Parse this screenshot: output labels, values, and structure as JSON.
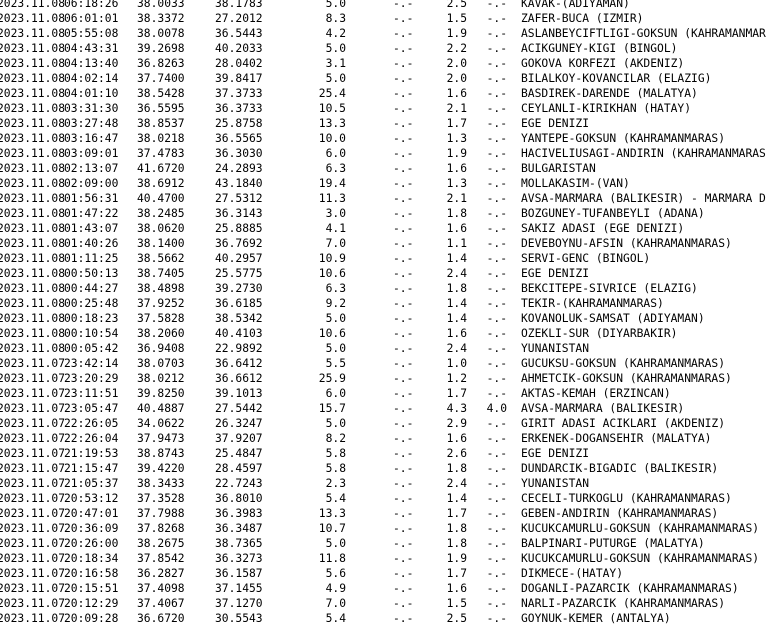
{
  "colors": {
    "background": "#ffffff",
    "text": "#000000"
  },
  "rows": [
    {
      "date": "2023.11.08",
      "time": "06:18:26",
      "lat": "38.0033",
      "lon": "38.1783",
      "depth": "5.0",
      "md": "-.-",
      "ml": "2.5",
      "mw": "-.-",
      "location": "KAVAK-(ADIYAMAN)"
    },
    {
      "date": "2023.11.08",
      "time": "06:01:01",
      "lat": "38.3372",
      "lon": "27.2012",
      "depth": "8.3",
      "md": "-.-",
      "ml": "1.5",
      "mw": "-.-",
      "location": "ZAFER-BUCA (IZMIR)"
    },
    {
      "date": "2023.11.08",
      "time": "05:55:08",
      "lat": "38.0078",
      "lon": "36.5443",
      "depth": "4.2",
      "md": "-.-",
      "ml": "1.9",
      "mw": "-.-",
      "location": "ASLANBEYCIFTLIGI-GOKSUN (KAHRAMANMARAS)"
    },
    {
      "date": "2023.11.08",
      "time": "04:43:31",
      "lat": "39.2698",
      "lon": "40.2033",
      "depth": "5.0",
      "md": "-.-",
      "ml": "2.2",
      "mw": "-.-",
      "location": "ACIKGUNEY-KIGI (BINGOL)"
    },
    {
      "date": "2023.11.08",
      "time": "04:13:40",
      "lat": "36.8263",
      "lon": "28.0402",
      "depth": "3.1",
      "md": "-.-",
      "ml": "2.0",
      "mw": "-.-",
      "location": "GOKOVA KORFEZI (AKDENIZ)"
    },
    {
      "date": "2023.11.08",
      "time": "04:02:14",
      "lat": "37.7400",
      "lon": "39.8417",
      "depth": "5.0",
      "md": "-.-",
      "ml": "2.0",
      "mw": "-.-",
      "location": "BILALKOY-KOVANCILAR (ELAZIG)"
    },
    {
      "date": "2023.11.08",
      "time": "04:01:10",
      "lat": "38.5428",
      "lon": "37.3733",
      "depth": "25.4",
      "md": "-.-",
      "ml": "1.6",
      "mw": "-.-",
      "location": "BASDIREK-DARENDE (MALATYA)"
    },
    {
      "date": "2023.11.08",
      "time": "03:31:30",
      "lat": "36.5595",
      "lon": "36.3733",
      "depth": "10.5",
      "md": "-.-",
      "ml": "2.1",
      "mw": "-.-",
      "location": "CEYLANLI-KIRIKHAN (HATAY)"
    },
    {
      "date": "2023.11.08",
      "time": "03:27:48",
      "lat": "38.8537",
      "lon": "25.8758",
      "depth": "13.3",
      "md": "-.-",
      "ml": "1.7",
      "mw": "-.-",
      "location": "EGE DENIZI"
    },
    {
      "date": "2023.11.08",
      "time": "03:16:47",
      "lat": "38.0218",
      "lon": "36.5565",
      "depth": "10.0",
      "md": "-.-",
      "ml": "1.3",
      "mw": "-.-",
      "location": "YANTEPE-GOKSUN (KAHRAMANMARAS)"
    },
    {
      "date": "2023.11.08",
      "time": "03:09:01",
      "lat": "37.4783",
      "lon": "36.3030",
      "depth": "6.0",
      "md": "-.-",
      "ml": "1.9",
      "mw": "-.-",
      "location": "HACIVELIUSAGI-ANDIRIN (KAHRAMANMARAS)"
    },
    {
      "date": "2023.11.08",
      "time": "02:13:07",
      "lat": "41.6720",
      "lon": "24.2893",
      "depth": "6.3",
      "md": "-.-",
      "ml": "1.6",
      "mw": "-.-",
      "location": "BULGARISTAN"
    },
    {
      "date": "2023.11.08",
      "time": "02:09:00",
      "lat": "38.6912",
      "lon": "43.1840",
      "depth": "19.4",
      "md": "-.-",
      "ml": "1.3",
      "mw": "-.-",
      "location": "MOLLAKASIM-(VAN)"
    },
    {
      "date": "2023.11.08",
      "time": "01:56:31",
      "lat": "40.4700",
      "lon": "27.5312",
      "depth": "11.3",
      "md": "-.-",
      "ml": "2.1",
      "mw": "-.-",
      "location": "AVSA-MARMARA (BALIKESIR) - MARMARA DE"
    },
    {
      "date": "2023.11.08",
      "time": "01:47:22",
      "lat": "38.2485",
      "lon": "36.3143",
      "depth": "3.0",
      "md": "-.-",
      "ml": "1.8",
      "mw": "-.-",
      "location": "BOZGUNEY-TUFANBEYLI (ADANA)"
    },
    {
      "date": "2023.11.08",
      "time": "01:43:07",
      "lat": "38.0620",
      "lon": "25.8885",
      "depth": "4.1",
      "md": "-.-",
      "ml": "1.6",
      "mw": "-.-",
      "location": "SAKIZ ADASI (EGE DENIZI)"
    },
    {
      "date": "2023.11.08",
      "time": "01:40:26",
      "lat": "38.1400",
      "lon": "36.7692",
      "depth": "7.0",
      "md": "-.-",
      "ml": "1.1",
      "mw": "-.-",
      "location": "DEVEBOYNU-AFSIN (KAHRAMANMARAS)"
    },
    {
      "date": "2023.11.08",
      "time": "01:11:25",
      "lat": "38.5662",
      "lon": "40.2957",
      "depth": "10.9",
      "md": "-.-",
      "ml": "1.4",
      "mw": "-.-",
      "location": "SERVI-GENC (BINGOL)"
    },
    {
      "date": "2023.11.08",
      "time": "00:50:13",
      "lat": "38.7405",
      "lon": "25.5775",
      "depth": "10.6",
      "md": "-.-",
      "ml": "2.4",
      "mw": "-.-",
      "location": "EGE DENIZI"
    },
    {
      "date": "2023.11.08",
      "time": "00:44:27",
      "lat": "38.4898",
      "lon": "39.2730",
      "depth": "6.3",
      "md": "-.-",
      "ml": "1.8",
      "mw": "-.-",
      "location": "BEKCITEPE-SIVRICE (ELAZIG)"
    },
    {
      "date": "2023.11.08",
      "time": "00:25:48",
      "lat": "37.9252",
      "lon": "36.6185",
      "depth": "9.2",
      "md": "-.-",
      "ml": "1.4",
      "mw": "-.-",
      "location": "TEKIR-(KAHRAMANMARAS)"
    },
    {
      "date": "2023.11.08",
      "time": "00:18:23",
      "lat": "37.5828",
      "lon": "38.5342",
      "depth": "5.0",
      "md": "-.-",
      "ml": "1.4",
      "mw": "-.-",
      "location": "KOVANOLUK-SAMSAT (ADIYAMAN)"
    },
    {
      "date": "2023.11.08",
      "time": "00:10:54",
      "lat": "38.2060",
      "lon": "40.4103",
      "depth": "10.6",
      "md": "-.-",
      "ml": "1.6",
      "mw": "-.-",
      "location": "OZEKLI-SUR (DIYARBAKIR)"
    },
    {
      "date": "2023.11.08",
      "time": "00:05:42",
      "lat": "36.9408",
      "lon": "22.9892",
      "depth": "5.0",
      "md": "-.-",
      "ml": "2.4",
      "mw": "-.-",
      "location": "YUNANISTAN"
    },
    {
      "date": "2023.11.07",
      "time": "23:42:14",
      "lat": "38.0703",
      "lon": "36.6412",
      "depth": "5.5",
      "md": "-.-",
      "ml": "1.0",
      "mw": "-.-",
      "location": "GUCUKSU-GOKSUN (KAHRAMANMARAS)"
    },
    {
      "date": "2023.11.07",
      "time": "23:20:29",
      "lat": "38.0212",
      "lon": "36.6612",
      "depth": "25.9",
      "md": "-.-",
      "ml": "1.2",
      "mw": "-.-",
      "location": "AHMETCIK-GOKSUN (KAHRAMANMARAS)"
    },
    {
      "date": "2023.11.07",
      "time": "23:11:51",
      "lat": "39.8250",
      "lon": "39.1013",
      "depth": "6.0",
      "md": "-.-",
      "ml": "1.7",
      "mw": "-.-",
      "location": "AKTAS-KEMAH (ERZINCAN)"
    },
    {
      "date": "2023.11.07",
      "time": "23:05:47",
      "lat": "40.4887",
      "lon": "27.5442",
      "depth": "15.7",
      "md": "-.-",
      "ml": "4.3",
      "mw": "4.0",
      "location": "AVSA-MARMARA (BALIKESIR)"
    },
    {
      "date": "2023.11.07",
      "time": "22:26:05",
      "lat": "34.0622",
      "lon": "26.3247",
      "depth": "5.0",
      "md": "-.-",
      "ml": "2.9",
      "mw": "-.-",
      "location": "GIRIT ADASI ACIKLARI (AKDENIZ)"
    },
    {
      "date": "2023.11.07",
      "time": "22:26:04",
      "lat": "37.9473",
      "lon": "37.9207",
      "depth": "8.2",
      "md": "-.-",
      "ml": "1.6",
      "mw": "-.-",
      "location": "ERKENEK-DOGANSEHIR (MALATYA)"
    },
    {
      "date": "2023.11.07",
      "time": "21:19:53",
      "lat": "38.8743",
      "lon": "25.4847",
      "depth": "5.8",
      "md": "-.-",
      "ml": "2.6",
      "mw": "-.-",
      "location": "EGE DENIZI"
    },
    {
      "date": "2023.11.07",
      "time": "21:15:47",
      "lat": "39.4220",
      "lon": "28.4597",
      "depth": "5.8",
      "md": "-.-",
      "ml": "1.8",
      "mw": "-.-",
      "location": "DUNDARCIK-BIGADIC (BALIKESIR)"
    },
    {
      "date": "2023.11.07",
      "time": "21:05:37",
      "lat": "38.3433",
      "lon": "22.7243",
      "depth": "2.3",
      "md": "-.-",
      "ml": "2.4",
      "mw": "-.-",
      "location": "YUNANISTAN"
    },
    {
      "date": "2023.11.07",
      "time": "20:53:12",
      "lat": "37.3528",
      "lon": "36.8010",
      "depth": "5.4",
      "md": "-.-",
      "ml": "1.4",
      "mw": "-.-",
      "location": "CECELI-TURKOGLU (KAHRAMANMARAS)"
    },
    {
      "date": "2023.11.07",
      "time": "20:47:01",
      "lat": "37.7988",
      "lon": "36.3983",
      "depth": "13.3",
      "md": "-.-",
      "ml": "1.7",
      "mw": "-.-",
      "location": "GEBEN-ANDIRIN (KAHRAMANMARAS)"
    },
    {
      "date": "2023.11.07",
      "time": "20:36:09",
      "lat": "37.8268",
      "lon": "36.3487",
      "depth": "10.7",
      "md": "-.-",
      "ml": "1.8",
      "mw": "-.-",
      "location": "KUCUKCAMURLU-GOKSUN (KAHRAMANMARAS)"
    },
    {
      "date": "2023.11.07",
      "time": "20:26:00",
      "lat": "38.2675",
      "lon": "38.7365",
      "depth": "5.0",
      "md": "-.-",
      "ml": "1.8",
      "mw": "-.-",
      "location": "BALPINARI-PUTURGE (MALATYA)"
    },
    {
      "date": "2023.11.07",
      "time": "20:18:34",
      "lat": "37.8542",
      "lon": "36.3273",
      "depth": "11.8",
      "md": "-.-",
      "ml": "1.9",
      "mw": "-.-",
      "location": "KUCUKCAMURLU-GOKSUN (KAHRAMANMARAS)"
    },
    {
      "date": "2023.11.07",
      "time": "20:16:58",
      "lat": "36.2827",
      "lon": "36.1587",
      "depth": "5.6",
      "md": "-.-",
      "ml": "1.7",
      "mw": "-.-",
      "location": "DIKMECE-(HATAY)"
    },
    {
      "date": "2023.11.07",
      "time": "20:15:51",
      "lat": "37.4098",
      "lon": "37.1455",
      "depth": "4.9",
      "md": "-.-",
      "ml": "1.6",
      "mw": "-.-",
      "location": "DOGANLI-PAZARCIK (KAHRAMANMARAS)"
    },
    {
      "date": "2023.11.07",
      "time": "20:12:29",
      "lat": "37.4067",
      "lon": "37.1270",
      "depth": "7.0",
      "md": "-.-",
      "ml": "1.5",
      "mw": "-.-",
      "location": "NARLI-PAZARCIK (KAHRAMANMARAS)"
    },
    {
      "date": "2023.11.07",
      "time": "20:09:28",
      "lat": "36.6720",
      "lon": "30.5543",
      "depth": "5.4",
      "md": "-.-",
      "ml": "2.5",
      "mw": "-.-",
      "location": "GOYNUK-KEMER (ANTALYA)"
    }
  ]
}
